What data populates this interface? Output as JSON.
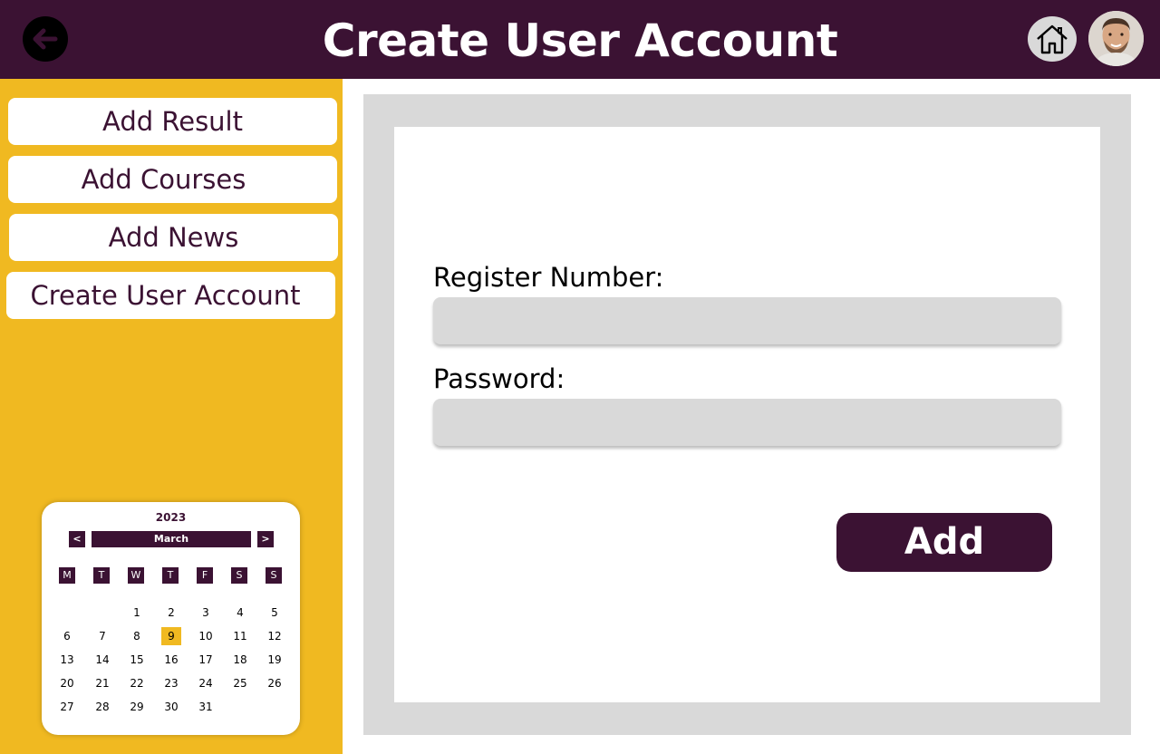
{
  "header": {
    "title": "Create User Account",
    "back_icon": "arrow-left-icon",
    "home_icon": "home-icon",
    "brand_color": "#3b1233"
  },
  "sidebar": {
    "accent_color": "#f0b921",
    "items": [
      {
        "label": "Add Result"
      },
      {
        "label": "Add Courses"
      },
      {
        "label": "Add News"
      },
      {
        "label": "Create User Account"
      }
    ]
  },
  "calendar": {
    "year": "2023",
    "month": "March",
    "prev_label": "<",
    "next_label": ">",
    "weekdays": [
      "M",
      "T",
      "W",
      "T",
      "F",
      "S",
      "S"
    ],
    "selected_date": "9",
    "dates": [
      "1",
      "2",
      "3",
      "4",
      "5",
      "6",
      "7",
      "8",
      "9",
      "10",
      "11",
      "12",
      "13",
      "14",
      "15",
      "16",
      "17",
      "18",
      "19",
      "20",
      "21",
      "22",
      "23",
      "24",
      "25",
      "26",
      "27",
      "28",
      "29",
      "30",
      "31"
    ]
  },
  "form": {
    "register_label": "Register Number:",
    "register_value": "",
    "password_label": "Password:",
    "password_value": "",
    "submit_label": "Add"
  }
}
